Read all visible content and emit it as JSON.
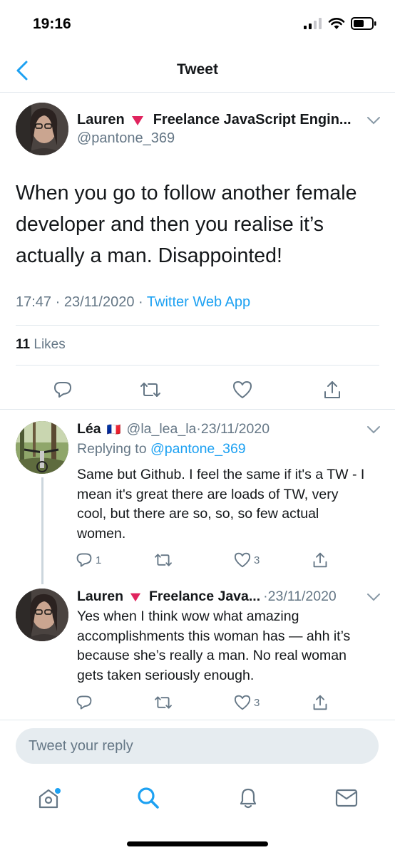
{
  "status_bar": {
    "time": "19:16"
  },
  "nav": {
    "title": "Tweet"
  },
  "main_tweet": {
    "author_name": "Lauren",
    "author_bio": "Freelance JavaScript Engin...",
    "handle": "@pantone_369",
    "text": "When you go to follow another female developer and then you realise it’s actually a man. Disappointed!",
    "time": "17:47",
    "date": "23/11/2020",
    "source": "Twitter Web App",
    "likes_count": "11",
    "likes_label": "Likes"
  },
  "replies": [
    {
      "name": "Léa",
      "flag": "🇫🇷",
      "handle": "@la_lea_la",
      "date": "23/11/2020",
      "replying_label": "Replying to",
      "replying_to": "@pantone_369",
      "text": "Same but Github. I feel the same if it's a TW - I mean it's great there are loads of TW, very cool, but there are so, so, so few actual women.",
      "reply_count": "1",
      "like_count": "3"
    },
    {
      "name": "Lauren",
      "bio": "Freelance Java...",
      "date": "23/11/2020",
      "text": "Yes when I think wow what amazing accomplishments this woman has — ahh it’s because she’s really a man. No real woman gets taken seriously enough.",
      "like_count": "3"
    }
  ],
  "composer": {
    "placeholder": "Tweet your reply"
  },
  "tabs": [
    "home-icon",
    "search-icon",
    "notifications-icon",
    "messages-icon"
  ],
  "icons": {
    "reply": "reply-icon",
    "retweet": "retweet-icon",
    "like": "heart-icon",
    "share": "share-icon",
    "chevron": "chevron-down-icon",
    "back": "back-chevron-icon",
    "triangle": "red-triangle-icon"
  },
  "colors": {
    "accent": "#1da1f2",
    "muted": "#657786",
    "text": "#14171a",
    "divider": "#e1e8ed",
    "triangle": "#e0245e"
  }
}
